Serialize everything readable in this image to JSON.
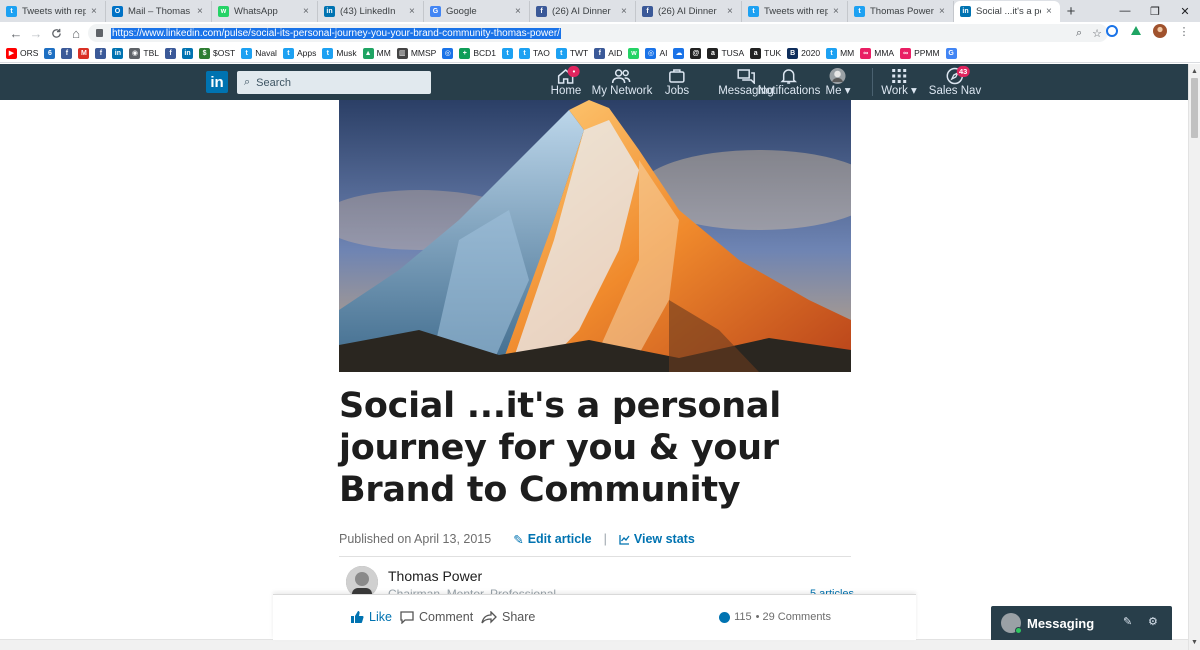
{
  "browser": {
    "tabs": [
      {
        "title": "Tweets with replies",
        "icon": "twitter-icon",
        "color": "#1da1f2",
        "glyph": "t"
      },
      {
        "title": "Mail – Thomas Pow",
        "icon": "outlook-icon",
        "color": "#0072c6",
        "glyph": "O"
      },
      {
        "title": "WhatsApp",
        "icon": "whatsapp-icon",
        "color": "#25d366",
        "glyph": "w"
      },
      {
        "title": "(43) LinkedIn",
        "icon": "linkedin-icon",
        "color": "#0073b1",
        "glyph": "in"
      },
      {
        "title": "Google",
        "icon": "google-icon",
        "color": "#4285f4",
        "glyph": "G"
      },
      {
        "title": "(26) AI Dinner",
        "icon": "facebook-icon",
        "color": "#3b5998",
        "glyph": "f"
      },
      {
        "title": "(26) AI Dinner",
        "icon": "facebook-icon",
        "color": "#3b5998",
        "glyph": "f"
      },
      {
        "title": "Tweets with replies",
        "icon": "twitter-icon",
        "color": "#1da1f2",
        "glyph": "t"
      },
      {
        "title": "Thomas Power on T",
        "icon": "twitter-icon",
        "color": "#1da1f2",
        "glyph": "t"
      },
      {
        "title": "Social ...it's a perso",
        "icon": "linkedin-icon",
        "color": "#0073b1",
        "glyph": "in",
        "active": true
      }
    ],
    "new_tab": "+",
    "window_controls": {
      "minimize": "—",
      "maximize": "❐",
      "close": "✕"
    },
    "nav": {
      "back": "←",
      "forward": "→",
      "reload": "C",
      "home": "⌂"
    },
    "url": "https://www.linkedin.com/pulse/social-its-personal-journey-you-your-brand-community-thomas-power/",
    "omni_icons": {
      "search": "⌕",
      "star": "☆"
    }
  },
  "bookmarks": [
    {
      "label": "ORS",
      "icon": "youtube-icon",
      "color": "#ff0000",
      "glyph": "▶"
    },
    {
      "label": "",
      "icon": "bookmark-6-icon",
      "color": "#1e6fc2",
      "glyph": "6"
    },
    {
      "label": "",
      "icon": "facebook-icon",
      "color": "#3b5998",
      "glyph": "f"
    },
    {
      "label": "",
      "icon": "gmail-icon",
      "color": "#d93025",
      "glyph": "M"
    },
    {
      "label": "",
      "icon": "facebook-icon",
      "color": "#3b5998",
      "glyph": "f"
    },
    {
      "label": "",
      "icon": "linkedin-icon",
      "color": "#0073b1",
      "glyph": "in"
    },
    {
      "label": "TBL",
      "icon": "globe-icon",
      "color": "#5f6368",
      "glyph": "◉"
    },
    {
      "label": "",
      "icon": "facebook-icon",
      "color": "#3b5998",
      "glyph": "f"
    },
    {
      "label": "",
      "icon": "linkedin-icon",
      "color": "#0073b1",
      "glyph": "in"
    },
    {
      "label": "$OST",
      "icon": "ost-icon",
      "color": "#2e7d32",
      "glyph": "$"
    },
    {
      "label": "Naval",
      "icon": "twitter-icon",
      "color": "#1da1f2",
      "glyph": "t"
    },
    {
      "label": "Apps",
      "icon": "twitter-icon",
      "color": "#1da1f2",
      "glyph": "t"
    },
    {
      "label": "Musk",
      "icon": "twitter-icon",
      "color": "#1da1f2",
      "glyph": "t"
    },
    {
      "label": "MM",
      "icon": "drive-icon",
      "color": "#1fa463",
      "glyph": "▲"
    },
    {
      "label": "MMSP",
      "icon": "chart-icon",
      "color": "#444444",
      "glyph": "▥"
    },
    {
      "label": "",
      "icon": "circle-icon",
      "color": "#1a73e8",
      "glyph": "◎"
    },
    {
      "label": "BCD1",
      "icon": "sheets-icon",
      "color": "#0f9d58",
      "glyph": "+"
    },
    {
      "label": "",
      "icon": "twitter-icon",
      "color": "#1da1f2",
      "glyph": "t"
    },
    {
      "label": "TAO",
      "icon": "twitter-icon",
      "color": "#1da1f2",
      "glyph": "t"
    },
    {
      "label": "TWT",
      "icon": "twitter-icon",
      "color": "#1da1f2",
      "glyph": "t"
    },
    {
      "label": "AID",
      "icon": "facebook-icon",
      "color": "#3b5998",
      "glyph": "f"
    },
    {
      "label": "",
      "icon": "whatsapp-icon",
      "color": "#25d366",
      "glyph": "w"
    },
    {
      "label": "AI",
      "icon": "ai-icon",
      "color": "#1a73e8",
      "glyph": "◎"
    },
    {
      "label": "",
      "icon": "cloud-icon",
      "color": "#1a73e8",
      "glyph": "☁"
    },
    {
      "label": "",
      "icon": "spiral-icon",
      "color": "#222222",
      "glyph": "@"
    },
    {
      "label": "TUSA",
      "icon": "amazon-icon",
      "color": "#222222",
      "glyph": "a"
    },
    {
      "label": "TUK",
      "icon": "amazon-icon",
      "color": "#222222",
      "glyph": "a"
    },
    {
      "label": "2020",
      "icon": "bi-icon",
      "color": "#0f2e5c",
      "glyph": "B"
    },
    {
      "label": "MM",
      "icon": "twitter-icon",
      "color": "#1da1f2",
      "glyph": "t"
    },
    {
      "label": "MMA",
      "icon": "infinity-icon",
      "color": "#e91e63",
      "glyph": "∞"
    },
    {
      "label": "PPMM",
      "icon": "infinity-icon",
      "color": "#e91e63",
      "glyph": "∞"
    },
    {
      "label": "",
      "icon": "google-icon",
      "color": "#4285f4",
      "glyph": "G"
    }
  ],
  "linkedin": {
    "logo": "in",
    "search_placeholder": "Search",
    "nav": [
      {
        "label": "Home",
        "icon": "home-icon",
        "badge": "•"
      },
      {
        "label": "My Network",
        "icon": "network-icon"
      },
      {
        "label": "Jobs",
        "icon": "jobs-icon"
      },
      {
        "label": "Messaging",
        "icon": "messaging-icon"
      },
      {
        "label": "Notifications",
        "icon": "notifications-icon"
      },
      {
        "label": "Me ▾",
        "icon": "avatar-icon"
      },
      {
        "label": "Work ▾",
        "icon": "grid-icon"
      },
      {
        "label": "Sales Nav",
        "icon": "compass-icon",
        "badge": "43"
      }
    ]
  },
  "article": {
    "hero_alt": "Snow-capped mountain peak at sunset",
    "title": "Social ...it's a personal journey for you & your Brand to Community",
    "published": "Published on April 13, 2015",
    "edit_label": "Edit article",
    "stats_label": "View stats",
    "separator": "|",
    "author_name": "Thomas Power",
    "author_subtitle": "Chairman, Mentor, Professional",
    "author_articles": "5 articles"
  },
  "action_bar": {
    "like": "Like",
    "comment": "Comment",
    "share": "Share",
    "reactions": "115",
    "comments": "• 29 Comments"
  },
  "messaging": {
    "label": "Messaging",
    "compose_icon": "✎",
    "settings_icon": "⚙"
  },
  "colors": {
    "linkedin_blue": "#0073b1",
    "nav_bg": "#283e4a",
    "notification_badge": "#e0245e"
  }
}
